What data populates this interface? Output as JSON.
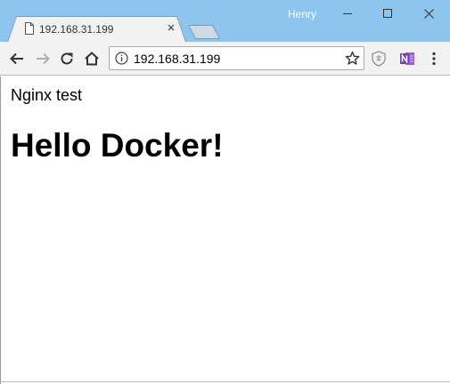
{
  "window": {
    "profile_name": "Henry",
    "colors": {
      "titlebar": "#8ec5ee",
      "toolbar": "#f2f2f2",
      "onenote": "#7b3fb5"
    }
  },
  "tab": {
    "title": "192.168.31.199",
    "close_glyph": "×",
    "favicon": "page-icon"
  },
  "toolbar": {
    "back_icon": "back-arrow-icon",
    "forward_icon": "forward-arrow-icon",
    "reload_icon": "reload-icon",
    "home_icon": "home-icon",
    "address": "192.168.31.199",
    "extensions": [
      "shield-extension-icon",
      "onenote-icon"
    ],
    "menu_icon": "menu-dots-icon"
  },
  "page": {
    "text": "Nginx test",
    "heading": "Hello Docker!"
  }
}
